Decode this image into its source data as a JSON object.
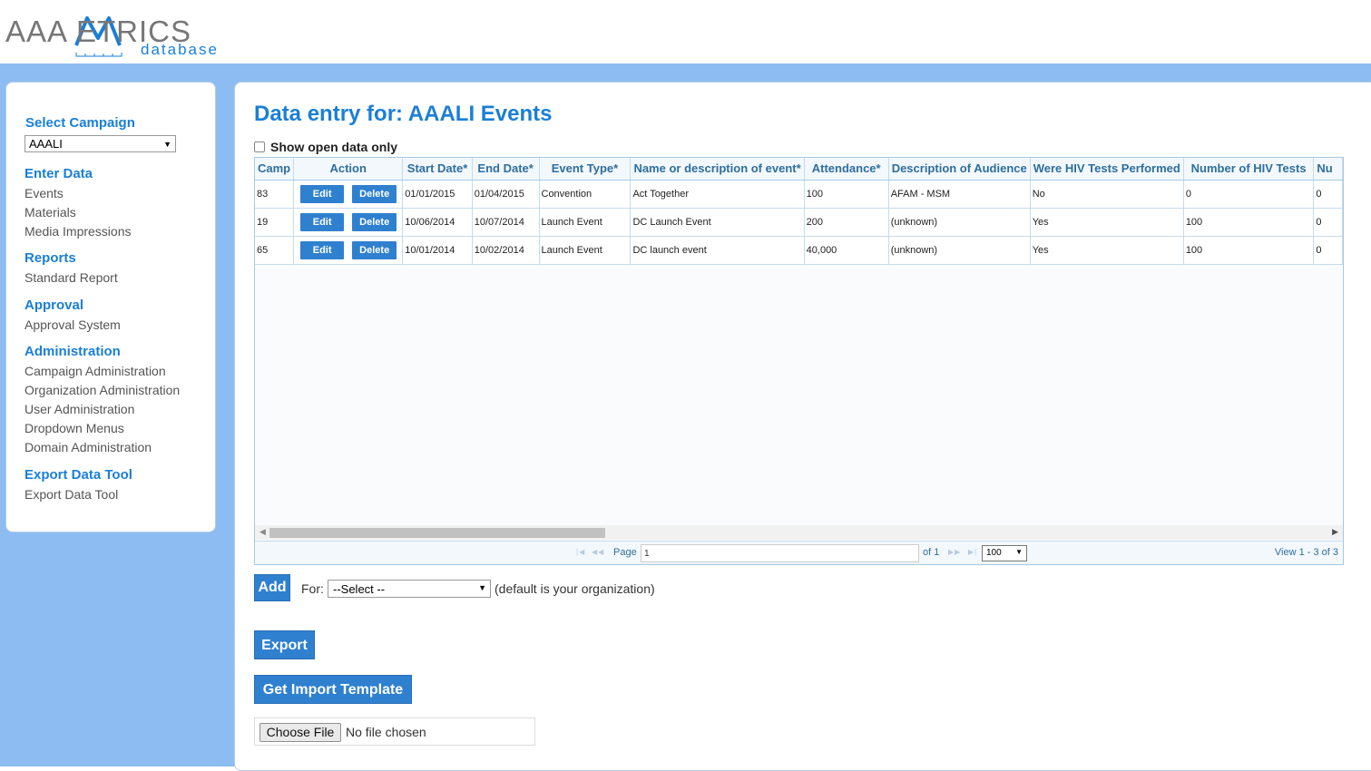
{
  "logo": {
    "part1": "AAA",
    "part2": "ETRICS",
    "sub": "database"
  },
  "sidebar": {
    "select_campaign": "Select Campaign",
    "campaign_value": "AAALI",
    "sections": [
      {
        "title": "Enter Data",
        "items": [
          "Events",
          "Materials",
          "Media Impressions"
        ]
      },
      {
        "title": "Reports",
        "items": [
          "Standard Report"
        ]
      },
      {
        "title": "Approval",
        "items": [
          "Approval System"
        ]
      },
      {
        "title": "Administration",
        "items": [
          "Campaign Administration",
          "Organization Administration",
          "User Administration",
          "Dropdown Menus",
          "Domain Administration"
        ]
      },
      {
        "title": "Export Data Tool",
        "items": [
          "Export Data Tool"
        ]
      }
    ]
  },
  "main": {
    "title": "Data entry for: AAALI Events",
    "open_only_label": "Show open data only",
    "grid": {
      "headers": [
        "Camp",
        "Action",
        "Start Date*",
        "End Date*",
        "Event Type*",
        "Name or description of event*",
        "Attendance*",
        "Description of Audience",
        "Were HIV Tests Performed",
        "Number of HIV Tests",
        "Nu"
      ],
      "edit_label": "Edit",
      "delete_label": "Delete",
      "rows": [
        [
          "83",
          "01/01/2015",
          "01/04/2015",
          "Convention",
          "Act Together",
          "100",
          "AFAM - MSM",
          "No",
          "0",
          "0"
        ],
        [
          "19",
          "10/06/2014",
          "10/07/2014",
          "Launch Event",
          "DC Launch Event",
          "200",
          "(unknown)",
          "Yes",
          "100",
          "0"
        ],
        [
          "65",
          "10/01/2014",
          "10/02/2014",
          "Launch Event",
          "DC launch event",
          "40,000",
          "(unknown)",
          "Yes",
          "100",
          "0"
        ]
      ],
      "pager": {
        "page_label": "Page",
        "page_value": "1",
        "of_label": "of 1",
        "rows_per_page": "100",
        "view_text": "View 1 - 3 of 3"
      }
    },
    "add_label": "Add",
    "for_label": "For:",
    "org_select_value": "--Select --",
    "default_note": "(default is your organization)",
    "export_label": "Export",
    "import_template_label": "Get Import Template",
    "choose_file_label": "Choose File",
    "no_file_label": "No file chosen"
  },
  "colors": {
    "accent": "#1a7fd6",
    "button": "#2f80cf",
    "band": "#8cbcf2",
    "grid_header_text": "#2e6e9e"
  },
  "icons": {
    "dropdown": "triangle-down-icon",
    "pager_first": "first-page-icon",
    "pager_prev": "prev-page-icon",
    "pager_next": "next-page-icon",
    "pager_last": "last-page-icon"
  }
}
